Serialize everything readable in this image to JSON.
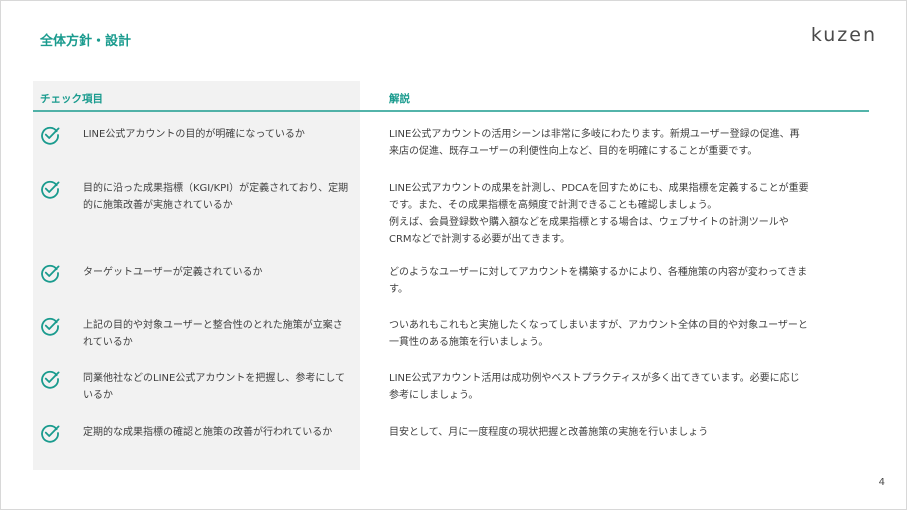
{
  "page": {
    "title": "全体方針・設計",
    "logo": "kuzen",
    "page_number": "4",
    "accent_color": "#1a9b8e"
  },
  "table": {
    "header_check": "チェック項目",
    "header_explanation": "解説",
    "rows": [
      {
        "item": "LINE公式アカウントの目的が明確になっているか",
        "explanation": "LINE公式アカウントの活用シーンは非常に多岐にわたります。新規ユーザー登録の促進、再\n来店の促進、既存ユーザーの利便性向上など、目的を明確にすることが重要です。"
      },
      {
        "item": "目的に沿った成果指標（KGI/KPI）が定義されており、定期的に施策改善が実施されているか",
        "explanation": "LINE公式アカウントの成果を計測し、PDCAを回すためにも、成果指標を定義することが重要\nです。また、その成果指標を高頻度で計測できることも確認しましょう。\n例えば、会員登録数や購入額などを成果指標とする場合は、ウェブサイトの計測ツールや\nCRMなどで計測する必要が出てきます。"
      },
      {
        "item": "ターゲットユーザーが定義されているか",
        "explanation": "どのようなユーザーに対してアカウントを構築するかにより、各種施策の内容が変わってきま\nす。"
      },
      {
        "item": "上記の目的や対象ユーザーと整合性のとれた施策が立案されているか",
        "explanation": "ついあれもこれもと実施したくなってしまいますが、アカウント全体の目的や対象ユーザーと\n一貫性のある施策を行いましょう。"
      },
      {
        "item": "同業他社などのLINE公式アカウントを把握し、参考にしているか",
        "explanation": "LINE公式アカウント活用は成功例やベストプラクティスが多く出てきています。必要に応じ\n参考にしましょう。"
      },
      {
        "item": "定期的な成果指標の確認と施策の改善が行われているか",
        "explanation": "目安として、月に一度程度の現状把握と改善施策の実施を行いましょう"
      }
    ]
  }
}
